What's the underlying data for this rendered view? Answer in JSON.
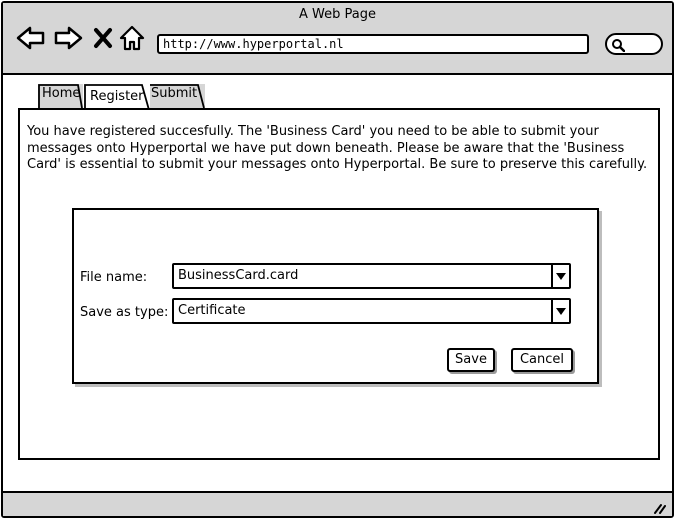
{
  "window": {
    "title": "A Web Page"
  },
  "browser": {
    "url": "http://www.hyperportal.nl",
    "icons": [
      "back-arrow-icon",
      "forward-arrow-icon",
      "close-icon",
      "home-icon",
      "search-icon",
      "resize-grip-icon"
    ]
  },
  "tabs": [
    {
      "label": "Home",
      "active": false
    },
    {
      "label": "Register",
      "active": true
    },
    {
      "label": "Submit",
      "active": false
    }
  ],
  "message": "You have registered succesfully. The 'Business Card' you need to be able to submit your messages onto Hyperportal we have put down beneath. Please be aware that the 'Business Card' is essential to submit your messages onto Hyperportal. Be sure to preserve this carefully.",
  "dialog": {
    "file_name_label": "File name:",
    "file_name_value": "BusinessCard.card",
    "save_type_label": "Save as type:",
    "save_type_value": "Certificate",
    "save_label": "Save",
    "cancel_label": "Cancel"
  },
  "colors": {
    "chrome": "#d6d6d6",
    "border": "#000000",
    "background": "#ffffff"
  }
}
